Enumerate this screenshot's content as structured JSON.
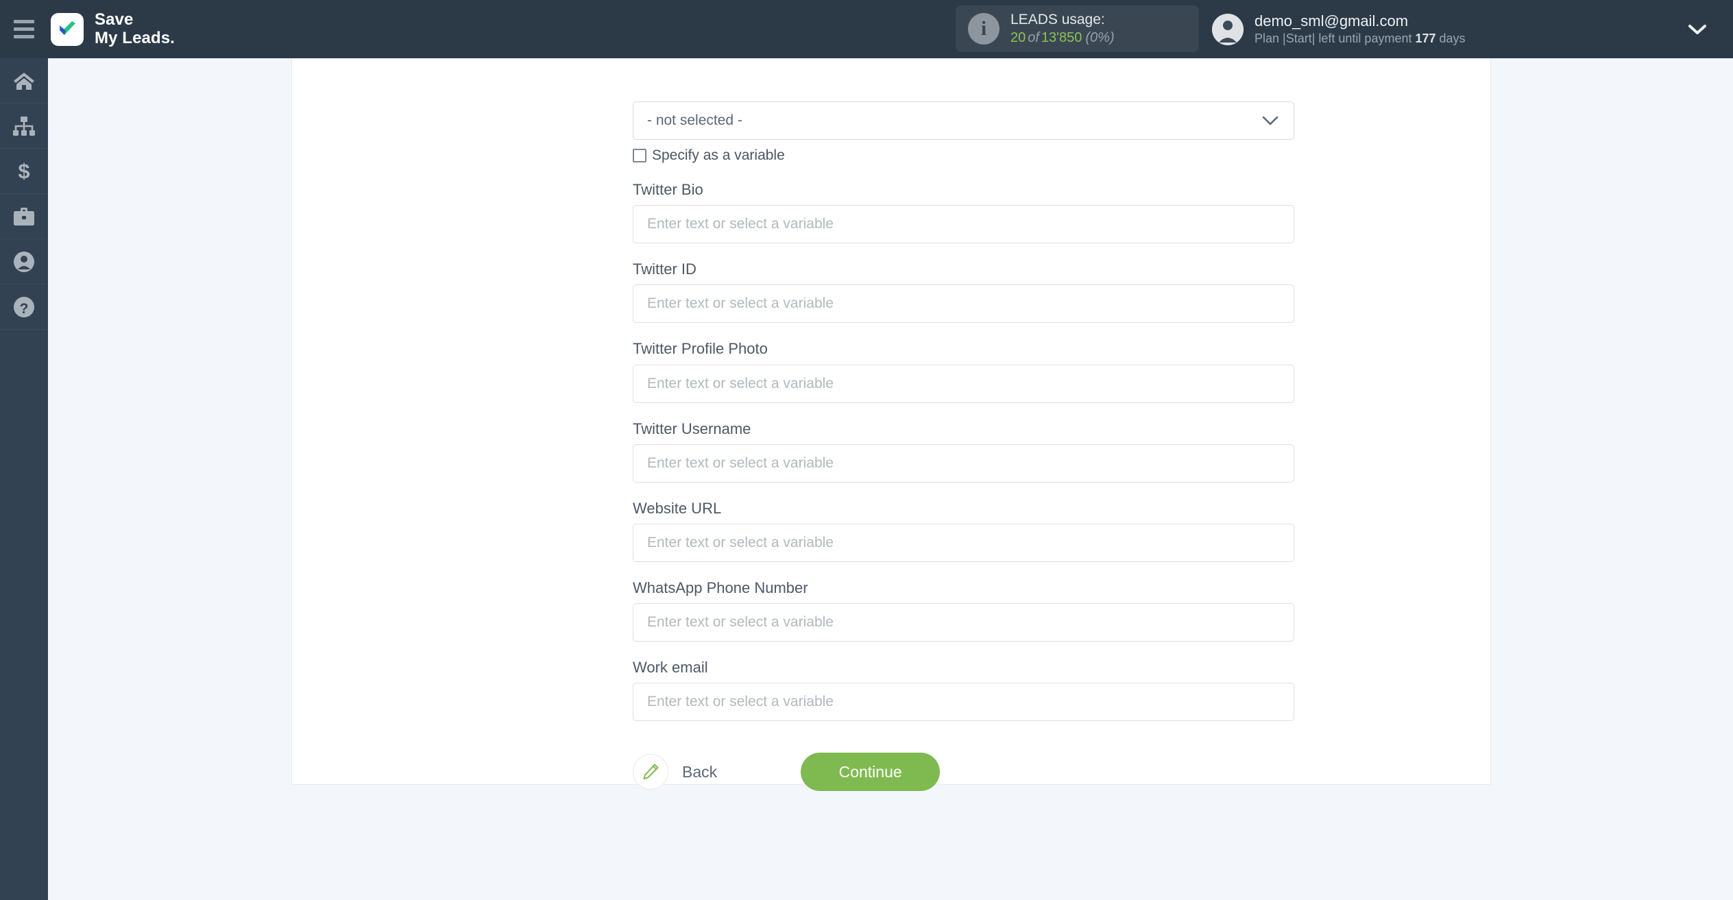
{
  "header": {
    "menu_icon": "hamburger-icon",
    "brand": {
      "logo_icon": "checkmark-logo-icon",
      "name": "Save\nMy Leads."
    },
    "usage": {
      "icon": "info-icon",
      "title": "LEADS usage:",
      "used": "20",
      "of": "of",
      "total": "13'850",
      "percent": "(0%)"
    },
    "account": {
      "avatar_icon": "user-avatar-icon",
      "email": "demo_sml@gmail.com",
      "plan_prefix": "Plan |Start| left until payment ",
      "plan_days": "177",
      "plan_suffix": " days",
      "caret_icon": "chevron-down-icon"
    }
  },
  "sidebar": {
    "items": [
      {
        "name": "home",
        "icon": "home-icon"
      },
      {
        "name": "connections",
        "icon": "sitemap-icon"
      },
      {
        "name": "billing",
        "icon": "dollar-icon"
      },
      {
        "name": "services",
        "icon": "briefcase-icon"
      },
      {
        "name": "profile",
        "icon": "user-icon"
      },
      {
        "name": "help",
        "icon": "question-circle-icon"
      }
    ]
  },
  "form": {
    "select": {
      "value": "- not selected -",
      "caret_icon": "chevron-down-icon"
    },
    "checkbox": {
      "label": "Specify as a variable",
      "checked": false
    },
    "placeholder": "Enter text or select a variable",
    "fields": [
      {
        "label": "Twitter Bio",
        "value": ""
      },
      {
        "label": "Twitter ID",
        "value": ""
      },
      {
        "label": "Twitter Profile Photo",
        "value": ""
      },
      {
        "label": "Twitter Username",
        "value": ""
      },
      {
        "label": "Website URL",
        "value": ""
      },
      {
        "label": "WhatsApp Phone Number",
        "value": ""
      },
      {
        "label": "Work email",
        "value": ""
      }
    ],
    "actions": {
      "back_label": "Back",
      "back_icon": "pencil-icon",
      "continue_label": "Continue"
    }
  },
  "colors": {
    "header_bg": "#2c3a48",
    "sidebar_bg": "#334252",
    "page_bg": "#f3f7fb",
    "accent_green": "#7fba51",
    "usage_green": "#8cc152"
  }
}
